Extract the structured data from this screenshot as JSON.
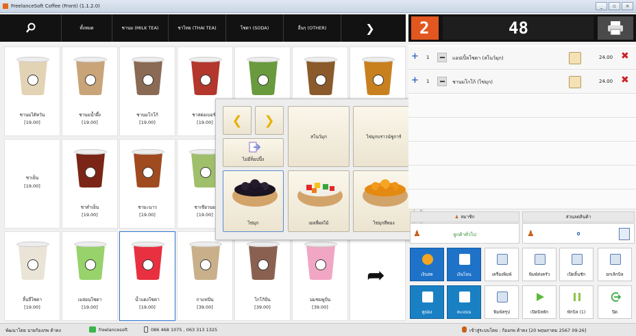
{
  "window": {
    "title": "FreelanceSoft Coffee (Front) (1.1.2.0)",
    "buttons": [
      "_",
      "▫",
      "×"
    ]
  },
  "categories": [
    {
      "label": ""
    },
    {
      "label": "ทั้งหมด"
    },
    {
      "label": "ชานม (MILK TEA)"
    },
    {
      "label": "ชาไทย (THAI TEA)"
    },
    {
      "label": "โซดา (SODA)"
    },
    {
      "label": "อื่นๆ (OTHER)"
    },
    {
      "label": "❯"
    }
  ],
  "display": {
    "queue": "2",
    "total": "48"
  },
  "products": [
    {
      "name": "ชานมไต้หวัน",
      "price": "[19.00]",
      "color": "#e3d3b5"
    },
    {
      "name": "ชานมน้ำผึ้ง",
      "price": "[19.00]",
      "color": "#c9a478"
    },
    {
      "name": "ชานมโกโก้",
      "price": "[19.00]",
      "color": "#8a6a54"
    },
    {
      "name": "ชาสตอเบอร์รี่",
      "price": "[19.00]",
      "color": "#b3372c"
    },
    {
      "name": "",
      "price": "",
      "color": "#6a9a3e"
    },
    {
      "name": "",
      "price": "",
      "color": "#8a5a2a"
    },
    {
      "name": "",
      "price": "",
      "color": "#c8801f"
    },
    {
      "name": "ชาเย็น",
      "price": "[19.00]",
      "color": ""
    },
    {
      "name": "ชาดำเย็น",
      "price": "[19.00]",
      "color": "#7a2516"
    },
    {
      "name": "ชามะนาว",
      "price": "[19.00]",
      "color": "#a04a20"
    },
    {
      "name": "ชาเขียวนม",
      "price": "[19.00]",
      "color": "#9fbf6a"
    },
    {
      "name": "",
      "price": "",
      "color": ""
    },
    {
      "name": "",
      "price": "",
      "color": ""
    },
    {
      "name": "",
      "price": "",
      "color": ""
    },
    {
      "name": "ลิ้นจี่โซดา",
      "price": "[19.00]",
      "color": "#e9e4d6"
    },
    {
      "name": "เมล่อนโซดา",
      "price": "[19.00]",
      "color": "#97d26a"
    },
    {
      "name": "น้ำแดงโซดา",
      "price": "[19.00]",
      "color": "#e83040"
    },
    {
      "name": "กาแฟปั่น",
      "price": "[39.00]",
      "color": "#c9b08a"
    },
    {
      "name": "โกโก้ปั่น",
      "price": "[39.00]",
      "color": "#8a6150"
    },
    {
      "name": "นมชมพูปั่น",
      "price": "[39.00]",
      "color": "#f1a6c4"
    },
    {
      "name": "➦",
      "price": "",
      "color": ""
    }
  ],
  "popup": {
    "prev": "❮",
    "next": "❯",
    "options": [
      {
        "label": "สโนว์มุก"
      },
      {
        "label": "ไข่มุกบราวน์ชูการ์"
      },
      {
        "label": "ไม่มีท็อปปิ้ง"
      },
      {
        "label": "ไข่มุก",
        "bowl": "pearls",
        "selected": true
      },
      {
        "label": "เยลลี่ผลไม้",
        "bowl": "jelly"
      },
      {
        "label": "ไข่มุกสีทอง",
        "bowl": "gold"
      }
    ]
  },
  "orders": [
    {
      "qty": "1",
      "name": "แอปเปิ้ลโซดา (สโนว์มุก)",
      "price": "24.00"
    },
    {
      "qty": "1",
      "name": "ชานมโกโก้ (ไข่มุก)",
      "price": "24.00"
    }
  ],
  "member": {
    "header": "สมาชิก",
    "customer": "ลูกค้าทั่วไป"
  },
  "discount": {
    "header": "ส่วนลดสินค้า",
    "value": "0"
  },
  "actions": [
    {
      "label": "เงินสด",
      "style": "blue",
      "icon": "coin-icon"
    },
    {
      "label": "เงินโอน",
      "style": "blue",
      "icon": "phone-transfer-icon"
    },
    {
      "label": "เครื่องพิมพ์",
      "style": "",
      "icon": "printer-icon"
    },
    {
      "label": "พิมพ์ส่งครัว",
      "style": "",
      "icon": "kitchen-print-icon"
    },
    {
      "label": "เปิดลิ้นชัก",
      "style": "",
      "icon": "drawer-icon"
    },
    {
      "label": "ยกเลิกบิล",
      "style": "",
      "icon": "cancel-bill-icon"
    },
    {
      "label": "คูปอง",
      "style": "teal",
      "icon": "coupon-icon"
    },
    {
      "label": "คะแนน",
      "style": "teal",
      "icon": "points-icon"
    },
    {
      "label": "พิมพ์สรุป",
      "style": "",
      "icon": "summary-icon"
    },
    {
      "label": "เปิดบิลพัก",
      "style": "",
      "icon": "play-icon"
    },
    {
      "label": "พักบิล (1)",
      "style": "",
      "icon": "pause-icon"
    },
    {
      "label": "ปิด",
      "style": "",
      "icon": "exit-icon"
    }
  ],
  "status": {
    "developer": "พัฒนาโดย นายก้องภพ ค้าคง",
    "line": "freelancesoft",
    "phone": "086 468 1075 , 063 313 1325",
    "login": "เข้าสู่ระบบโดย : ก้องภพ ค้าคง [20 พฤษภาคม 2567 09:26]"
  }
}
